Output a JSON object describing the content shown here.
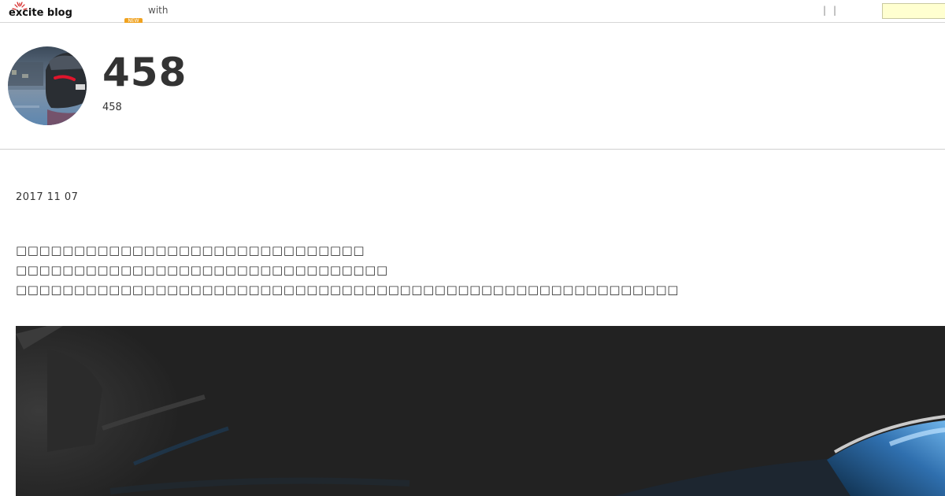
{
  "topbar": {
    "logo_text": "excite blog",
    "new_badge": "NEW",
    "with_link": "with",
    "separators": [
      "|",
      "|"
    ],
    "search_placeholder": ""
  },
  "header": {
    "title": "458",
    "subtitle": "458",
    "avatar_icon": "car-photo"
  },
  "post": {
    "date": "2017 11 07",
    "lines": [
      "□□□□□□□□□□□□□□□□□□□□□□□□□□□□□□",
      "□□□□□□□□□□□□□□□□□□□□□□□□□□□□□□□□",
      "□□□□□□□□□□□□□□□□□□□□□□□□□□□□□□□□□□□□□□□□□□□□□□□□□□□□□□□□□"
    ],
    "image_icon": "car-night-photo"
  },
  "colors": {
    "accent_badge": "#f0a21f",
    "search_bg": "#ffffd0",
    "text": "#333333",
    "image_bg": "#222222"
  }
}
